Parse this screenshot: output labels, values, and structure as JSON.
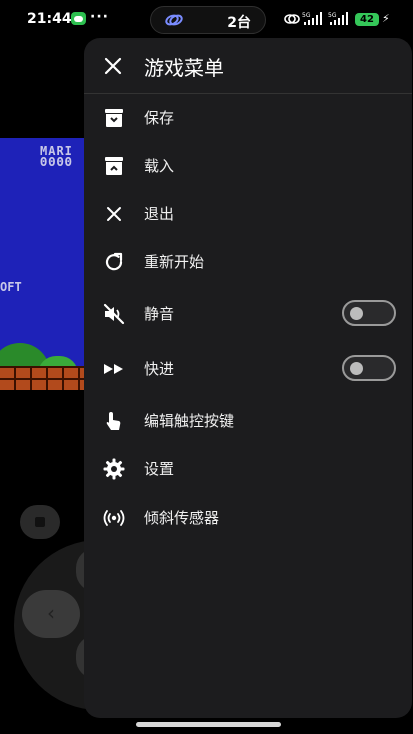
{
  "status_bar": {
    "time": "21:44",
    "more": "···",
    "island_count": "2台",
    "battery": "42"
  },
  "game": {
    "title_text": "MARI\n0000",
    "soft_text": "OFT"
  },
  "menu": {
    "title": "游戏菜单",
    "items": [
      {
        "label": "保存",
        "icon": "save-icon"
      },
      {
        "label": "载入",
        "icon": "load-icon"
      },
      {
        "label": "退出",
        "icon": "exit-icon"
      },
      {
        "label": "重新开始",
        "icon": "restart-icon"
      },
      {
        "label": "静音",
        "icon": "mute-icon",
        "toggle": false
      },
      {
        "label": "快进",
        "icon": "fast-forward-icon",
        "toggle": false
      },
      {
        "label": "编辑触控按键",
        "icon": "touch-icon"
      },
      {
        "label": "设置",
        "icon": "gear-icon"
      },
      {
        "label": "倾斜传感器",
        "icon": "sensor-icon"
      }
    ]
  },
  "colors": {
    "panel": "#1c1c1e",
    "game_sky": "#1e22b8",
    "battery": "#35c759"
  }
}
